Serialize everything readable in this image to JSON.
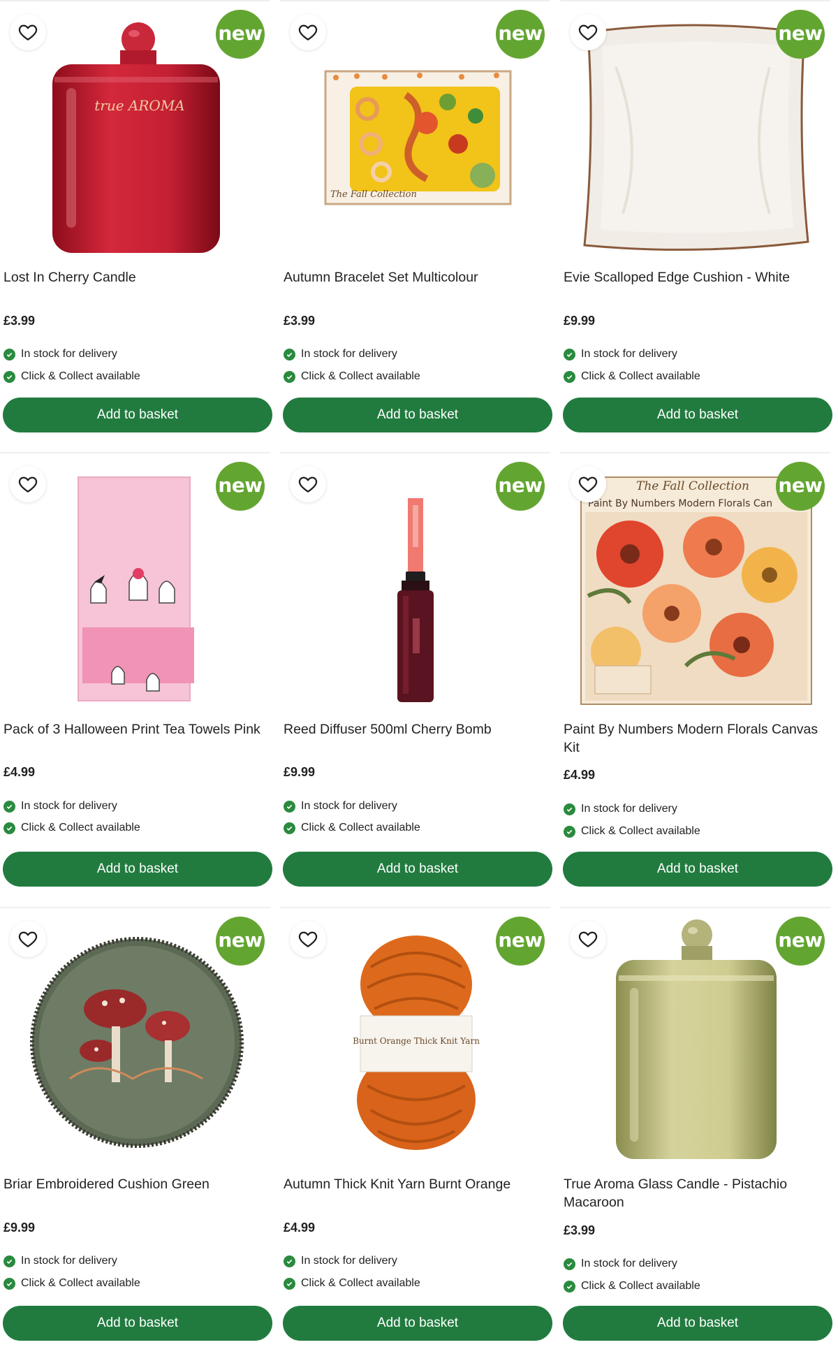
{
  "badge_label": "new",
  "colors": {
    "accent_green": "#217b3f",
    "badge_green": "#63a531",
    "check_green": "#2a8a3e"
  },
  "icons": {
    "wishlist": "heart-outline-icon",
    "status": "check-circle-icon"
  },
  "products": [
    {
      "name": "Lost In Cherry Candle",
      "price": "£3.99",
      "stock": "In stock for delivery",
      "collect": "Click & Collect available",
      "cta": "Add to basket",
      "image_text": "true AROMA"
    },
    {
      "name": "Autumn Bracelet Set Multicolour",
      "price": "£3.99",
      "stock": "In stock for delivery",
      "collect": "Click & Collect available",
      "cta": "Add to basket",
      "image_text": "The Fall Collection"
    },
    {
      "name": "Evie Scalloped Edge Cushion - White",
      "price": "£9.99",
      "stock": "In stock for delivery",
      "collect": "Click & Collect available",
      "cta": "Add to basket"
    },
    {
      "name": "Pack of 3 Halloween Print Tea Towels Pink",
      "price": "£4.99",
      "stock": "In stock for delivery",
      "collect": "Click & Collect available",
      "cta": "Add to basket"
    },
    {
      "name": "Reed Diffuser 500ml Cherry Bomb",
      "price": "£9.99",
      "stock": "In stock for delivery",
      "collect": "Click & Collect available",
      "cta": "Add to basket"
    },
    {
      "name": "Paint By Numbers Modern Florals Canvas Kit",
      "price": "£4.99",
      "stock": "In stock for delivery",
      "collect": "Click & Collect available",
      "cta": "Add to basket",
      "image_text": "The Fall Collection",
      "image_subtext": "Paint By Numbers Modern Florals Can"
    },
    {
      "name": "Briar Embroidered Cushion Green",
      "price": "£9.99",
      "stock": "In stock for delivery",
      "collect": "Click & Collect available",
      "cta": "Add to basket"
    },
    {
      "name": "Autumn Thick Knit Yarn Burnt Orange",
      "price": "£4.99",
      "stock": "In stock for delivery",
      "collect": "Click & Collect available",
      "cta": "Add to basket",
      "image_text": "Burnt Orange Thick Knit Yarn"
    },
    {
      "name": "True Aroma Glass Candle - Pistachio Macaroon",
      "price": "£3.99",
      "stock": "In stock for delivery",
      "collect": "Click & Collect available",
      "cta": "Add to basket"
    }
  ]
}
